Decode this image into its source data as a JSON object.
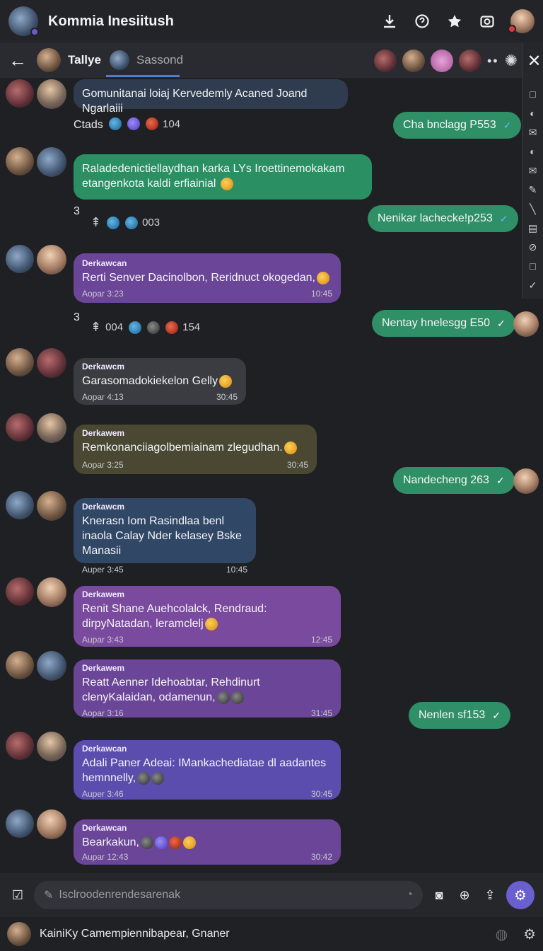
{
  "header": {
    "title": "Kommia Inesiitush",
    "icons": [
      "download-icon",
      "help-icon",
      "star-icon",
      "camera-icon",
      "profile-avatar"
    ]
  },
  "tabbar": {
    "tab1_label": "Tallye",
    "tab2_label": "Sassond",
    "more": "••"
  },
  "sidebar": {
    "close": "✕",
    "tools": [
      "□",
      "◐",
      "✉",
      "◐",
      "✉",
      "✎",
      "╲",
      "▤",
      "⊘",
      "□",
      "✓"
    ]
  },
  "messages": [
    {
      "text": "Gomunitanai loiaj Kervedemly Acaned Joand Ngarlaiii"
    },
    {
      "row_label": "Ctads",
      "count": "104"
    },
    {
      "outgoing": "Cha bnclagg P553"
    },
    {
      "text": "Raladedenictiellaydhan karka LYs Iroettinemokakam etangenkota kaldi erfiainial"
    },
    {
      "row_number": "3",
      "count": "003"
    },
    {
      "outgoing": "Nenikar lachecke!p253"
    },
    {
      "sender": "Derkawcan",
      "text": "Rerti Senver Dacinolbon, Reridnuct okogedan,",
      "meta_left": "Aopar 3:23",
      "meta_right": "10:45"
    },
    {
      "row_number": "3",
      "count_a": "004",
      "count_b": "154"
    },
    {
      "outgoing": "Nentay hnelesgg E50"
    },
    {
      "sender": "Derkawcm",
      "text": "Garasomadokiekelon Gelly",
      "meta_left": "Aopar 4:13",
      "meta_right": "30:45"
    },
    {
      "sender": "Derkawem",
      "text": "Remkonanciiagolbemiainam zlegudhan.",
      "meta_left": "Aopar 3:25",
      "meta_right": "30:45"
    },
    {
      "outgoing": "Nandecheng 263"
    },
    {
      "sender": "Derkawcm",
      "text": "Knerasn Iom Rasindlaa benl inaola Calay Nder kelasey Bske Manasii",
      "meta_left": "Auper 3:45",
      "meta_right": "10:45"
    },
    {
      "sender": "Derkawem",
      "text": "Renit Shane Auehcolalck, Rendraud: dirpyNatadan, leramclelj",
      "meta_left": "Aupar 3:43",
      "meta_right": "12:45"
    },
    {
      "sender": "Derkawem",
      "text": "Reatt Aenner Idehoabtar, Rehdinurt clenyKalaidan, odamenun,",
      "meta_left": "Aopar 3:16",
      "meta_right": "31:45"
    },
    {
      "outgoing": "Nenlen sf153"
    },
    {
      "sender": "Derkawcan",
      "text": "Adali Paner Adeai: IMankachediatae dl aadantes hemnnelly,",
      "meta_left": "Auper 3:46",
      "meta_right": "30:45"
    },
    {
      "sender": "Derkawcan",
      "text": "Bearkakun,",
      "meta_left": "Aupar 12:43",
      "meta_right": "30:42"
    }
  ],
  "composer": {
    "placeholder": "Isclroodenrendesarenak"
  },
  "bottombar": {
    "text": "KainiKy Camempiennibapear, Gnaner"
  },
  "colors": {
    "accent": "#4e7bd6",
    "outgoing_bubble": "#2f8f66",
    "send_button": "#6a5fcf"
  }
}
